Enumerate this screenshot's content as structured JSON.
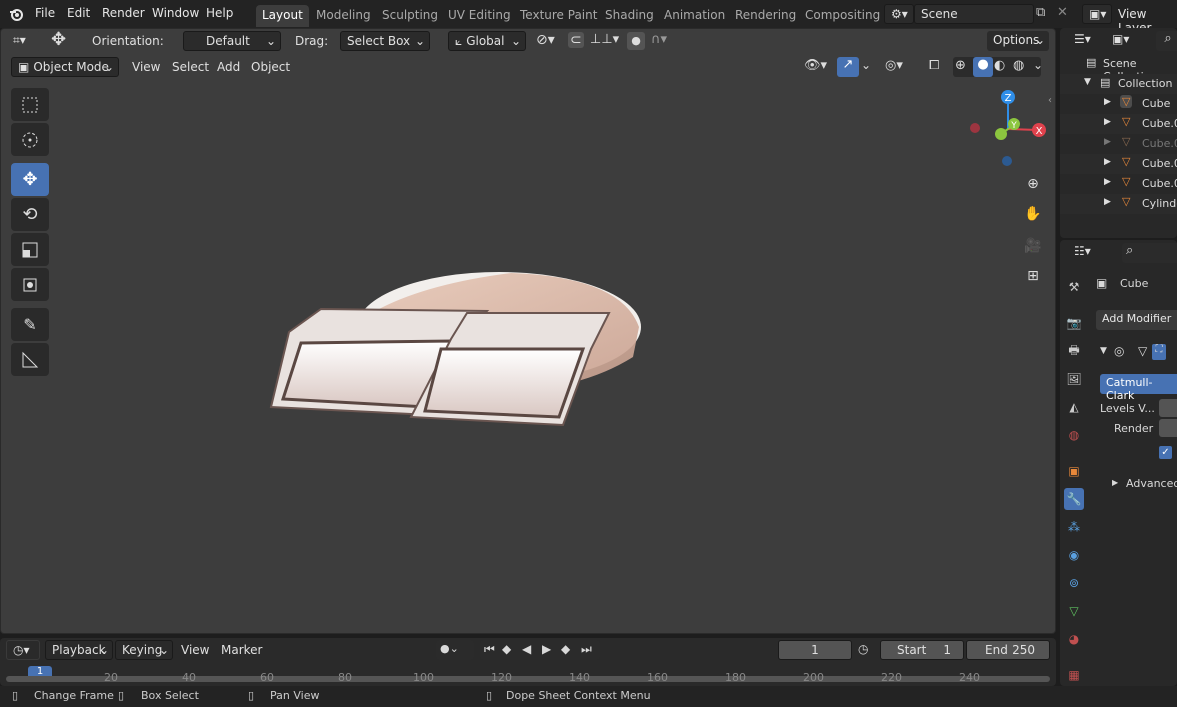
{
  "menu": {
    "file": "File",
    "edit": "Edit",
    "render": "Render",
    "window": "Window",
    "help": "Help"
  },
  "workspaces": [
    "Layout",
    "Modeling",
    "Sculpting",
    "UV Editing",
    "Texture Paint",
    "Shading",
    "Animation",
    "Rendering",
    "Compositing"
  ],
  "scene": {
    "name": "Scene",
    "view_layer": "View Layer"
  },
  "tool_header": {
    "orientation_label": "Orientation:",
    "orientation_value": "Default",
    "drag_label": "Drag:",
    "drag_value": "Select Box",
    "transform_orientation": "Global",
    "options": "Options"
  },
  "viewport_header": {
    "mode": "Object Mode",
    "view": "View",
    "select": "Select",
    "add": "Add",
    "object": "Object"
  },
  "gizmo": {
    "z": "Z",
    "y": "Y",
    "x": "X"
  },
  "outliner": {
    "scene_collection": "Scene Collection",
    "collection": "Collection",
    "items": [
      "Cube",
      "Cube.0",
      "Cube.0",
      "Cube.0",
      "Cube.0",
      "Cylinde"
    ]
  },
  "properties": {
    "object_name": "Cube",
    "add_modifier": "Add Modifier",
    "subdiv_type": "Catmull-Clark",
    "levels_viewport": "Levels V...",
    "render": "Render",
    "advanced": "Advanced"
  },
  "timeline": {
    "playback": "Playback",
    "keying": "Keying",
    "view": "View",
    "marker": "Marker",
    "current_frame": "1",
    "start_label": "Start",
    "start_value": "1",
    "end_label": "End",
    "end_value": "250",
    "ticks": [
      "20",
      "40",
      "60",
      "80",
      "100",
      "120",
      "140",
      "160",
      "180",
      "200",
      "220",
      "240"
    ],
    "cursor_frame": "1"
  },
  "status": {
    "change_frame": "Change Frame",
    "box_select": "Box Select",
    "pan_view": "Pan View",
    "context_menu": "Dope Sheet Context Menu"
  },
  "colors": {
    "accent": "#4772b3",
    "x_axis": "#e0424d",
    "y_axis": "#8cc63f",
    "z_axis": "#2f8ee8",
    "object_orange": "#e8883a"
  }
}
